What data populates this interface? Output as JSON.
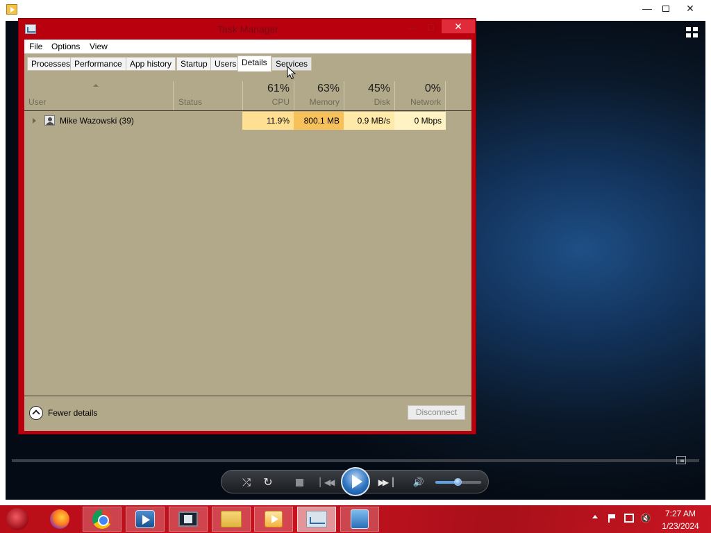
{
  "player": {
    "controls": {
      "shuffle_icon": "shuffle-icon",
      "repeat_icon": "repeat-icon",
      "stop_icon": "stop-icon",
      "previous_icon": "previous-icon",
      "play_icon": "play-icon",
      "next_icon": "next-icon",
      "volume_icon": "volume-icon",
      "volume_level": 0.5
    }
  },
  "task_manager": {
    "title": "Task Manager",
    "close_label": "✕",
    "menu": [
      "File",
      "Options",
      "View"
    ],
    "tabs": [
      "Processes",
      "Performance",
      "App history",
      "Startup",
      "Users",
      "Details",
      "Services"
    ],
    "active_tab": "Details",
    "columns": {
      "user": {
        "label": "User"
      },
      "status": {
        "label": "Status"
      },
      "cpu": {
        "percent": "61%",
        "label": "CPU"
      },
      "memory": {
        "percent": "63%",
        "label": "Memory"
      },
      "disk": {
        "percent": "45%",
        "label": "Disk"
      },
      "network": {
        "percent": "0%",
        "label": "Network"
      }
    },
    "rows": [
      {
        "user": "Mike Wazowski (39)",
        "status": "",
        "cpu": "11.9%",
        "memory": "800.1 MB",
        "disk": "0.9 MB/s",
        "network": "0 Mbps"
      }
    ],
    "footer": {
      "fewer_details": "Fewer details",
      "disconnect": "Disconnect"
    }
  },
  "taskbar": {
    "apps": [
      "firefox-icon",
      "chrome-icon",
      "media-player-icon",
      "video-editor-icon",
      "file-explorer-icon",
      "media-player-2-icon",
      "task-manager-icon",
      "network-app-icon"
    ],
    "clock": {
      "time": "7:27 AM",
      "date": "1/23/2024"
    }
  },
  "colors": {
    "titlebar_accent": "#b8000f",
    "close_button": "#e02c3a",
    "content_background": "#b1a98a",
    "cpu_heat": "#ffdf91",
    "memory_heat": "#f6c05a",
    "disk_heat": "#ffe9a8",
    "network_heat": "#fff3c3"
  }
}
